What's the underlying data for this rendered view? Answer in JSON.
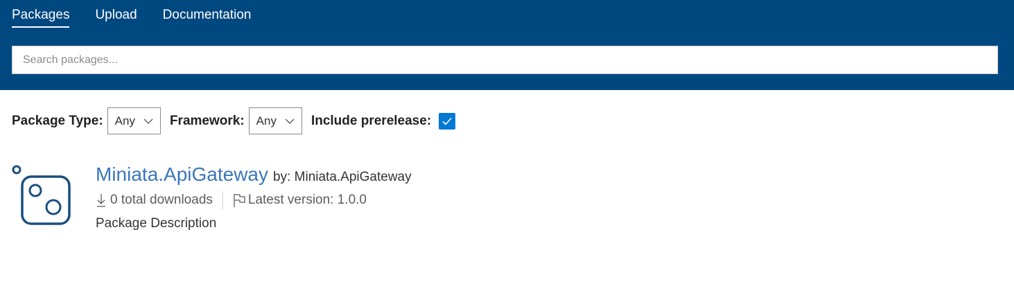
{
  "nav": {
    "items": [
      {
        "label": "Packages",
        "active": true
      },
      {
        "label": "Upload",
        "active": false
      },
      {
        "label": "Documentation",
        "active": false
      }
    ]
  },
  "search": {
    "placeholder": "Search packages...",
    "value": ""
  },
  "filters": {
    "package_type_label": "Package Type:",
    "package_type_value": "Any",
    "framework_label": "Framework:",
    "framework_value": "Any",
    "prerelease_label": "Include prerelease:",
    "prerelease_checked": true
  },
  "package": {
    "name": "Miniata.ApiGateway",
    "by": "by: Miniata.ApiGateway",
    "downloads": "0 total downloads",
    "latest_version": "Latest version: 1.0.0",
    "description": "Package Description",
    "icon": "package-default-icon"
  },
  "colors": {
    "header_bg": "#004880",
    "link": "#3b76b9",
    "checkbox": "#0078d4"
  }
}
